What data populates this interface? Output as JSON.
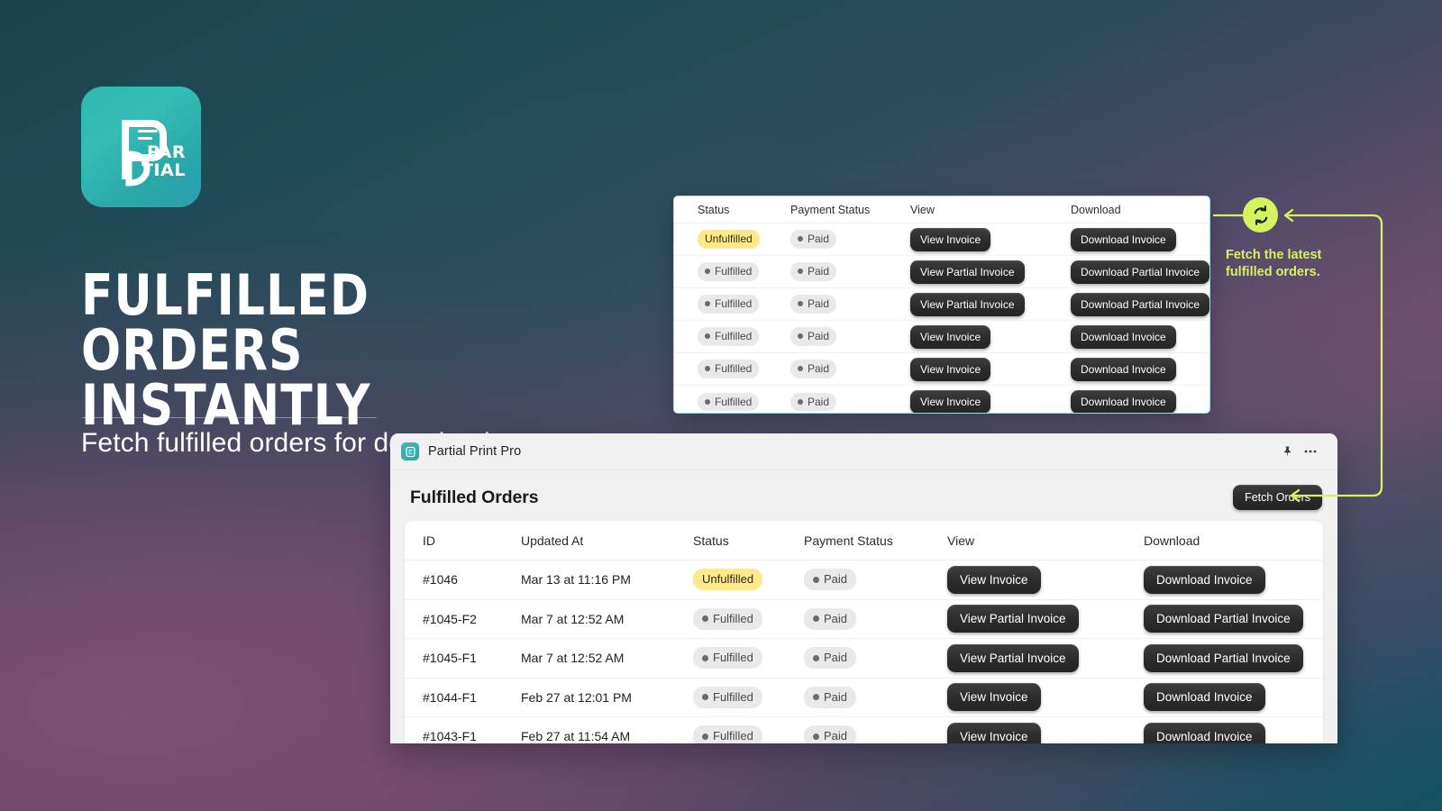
{
  "brand": {
    "logo_icon": "partial-logo-icon",
    "logo_text_line1": "PAR",
    "logo_text_line2": "TIAL"
  },
  "promo": {
    "title_line1": "Fulfilled Orders",
    "title_line2": "Instantly",
    "subtitle": "Fetch fulfilled orders for download."
  },
  "colors": {
    "accent_lime": "#d6f25f",
    "brand_teal": "#2fb8b0",
    "bg_teal": "#1d4452",
    "bg_purple": "#7a4f72",
    "badge_yellow": "#ffea8a",
    "badge_grey": "#e9e9eb",
    "button_dark": "#2d2d2d",
    "card_border": "#a9d9e4"
  },
  "callout": {
    "icon": "refresh-sync-icon",
    "text_line1": "Fetch the latest",
    "text_line2": "fulfilled orders.",
    "text": "Fetch the latest fulfilled orders."
  },
  "top_table": {
    "columns": [
      "Status",
      "Payment Status",
      "View",
      "Download"
    ],
    "rows": [
      {
        "status": "Unfulfilled",
        "status_variant": "yellow",
        "payment_status": "Paid",
        "view_label": "View Invoice",
        "download_label": "Download Invoice"
      },
      {
        "status": "Fulfilled",
        "status_variant": "grey",
        "payment_status": "Paid",
        "view_label": "View Partial Invoice",
        "download_label": "Download Partial Invoice"
      },
      {
        "status": "Fulfilled",
        "status_variant": "grey",
        "payment_status": "Paid",
        "view_label": "View Partial Invoice",
        "download_label": "Download Partial Invoice"
      },
      {
        "status": "Fulfilled",
        "status_variant": "grey",
        "payment_status": "Paid",
        "view_label": "View Invoice",
        "download_label": "Download Invoice"
      },
      {
        "status": "Fulfilled",
        "status_variant": "grey",
        "payment_status": "Paid",
        "view_label": "View Invoice",
        "download_label": "Download Invoice"
      },
      {
        "status": "Fulfilled",
        "status_variant": "grey",
        "payment_status": "Paid",
        "view_label": "View Invoice",
        "download_label": "Download Invoice"
      }
    ]
  },
  "app": {
    "window_title": "Partial Print Pro",
    "app_icon": "partial-print-pro-icon",
    "pin_icon": "pin-icon",
    "more_icon": "more-horizontal-icon",
    "page_title": "Fulfilled Orders",
    "fetch_button": "Fetch Orders",
    "table": {
      "columns": [
        "ID",
        "Updated At",
        "Status",
        "Payment Status",
        "View",
        "Download"
      ],
      "rows": [
        {
          "id": "#1046",
          "updated_at": "Mar 13 at 11:16 PM",
          "status": "Unfulfilled",
          "status_variant": "yellow",
          "payment_status": "Paid",
          "view_label": "View Invoice",
          "download_label": "Download Invoice"
        },
        {
          "id": "#1045-F2",
          "updated_at": "Mar 7 at 12:52 AM",
          "status": "Fulfilled",
          "status_variant": "grey",
          "payment_status": "Paid",
          "view_label": "View Partial Invoice",
          "download_label": "Download Partial Invoice"
        },
        {
          "id": "#1045-F1",
          "updated_at": "Mar 7 at 12:52 AM",
          "status": "Fulfilled",
          "status_variant": "grey",
          "payment_status": "Paid",
          "view_label": "View Partial Invoice",
          "download_label": "Download Partial Invoice"
        },
        {
          "id": "#1044-F1",
          "updated_at": "Feb 27 at 12:01 PM",
          "status": "Fulfilled",
          "status_variant": "grey",
          "payment_status": "Paid",
          "view_label": "View Invoice",
          "download_label": "Download Invoice"
        },
        {
          "id": "#1043-F1",
          "updated_at": "Feb 27 at 11:54 AM",
          "status": "Fulfilled",
          "status_variant": "grey",
          "payment_status": "Paid",
          "view_label": "View Invoice",
          "download_label": "Download Invoice"
        }
      ]
    }
  }
}
